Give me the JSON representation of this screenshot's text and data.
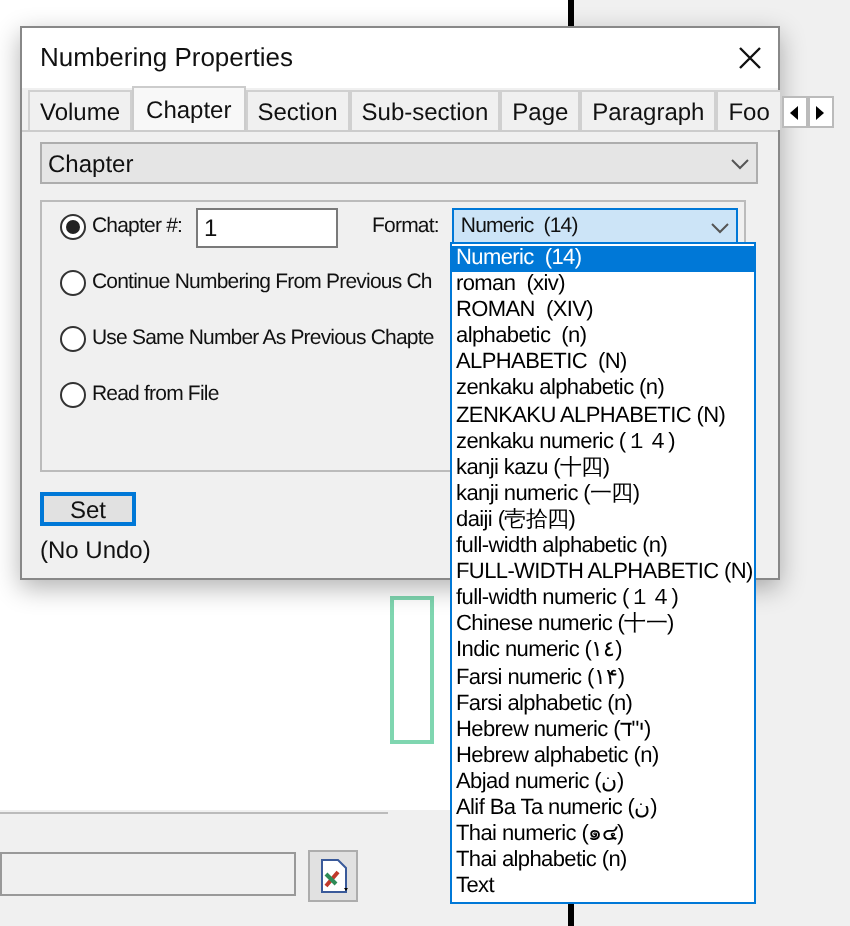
{
  "window": {
    "title": "Numbering Properties"
  },
  "tabs": [
    {
      "label": "Volume",
      "selected": false
    },
    {
      "label": "Chapter",
      "selected": true
    },
    {
      "label": "Section",
      "selected": false
    },
    {
      "label": "Sub-section",
      "selected": false
    },
    {
      "label": "Page",
      "selected": false
    },
    {
      "label": "Paragraph",
      "selected": false
    },
    {
      "label": "Foo",
      "selected": false
    }
  ],
  "level_select": {
    "value": "Chapter"
  },
  "options": [
    {
      "kind": "number",
      "label": "Chapter #:",
      "selected": true,
      "value": "1"
    },
    {
      "kind": "plain",
      "label": "Continue Numbering From Previous Ch",
      "selected": false
    },
    {
      "kind": "plain",
      "label": "Use Same Number As Previous Chapte",
      "selected": false
    },
    {
      "kind": "plain",
      "label": "Read from File",
      "selected": false
    }
  ],
  "format": {
    "label": "Format:",
    "value": "Numeric  (14)",
    "expanded": true,
    "items": [
      {
        "label": "Numeric  (14)",
        "selected": true
      },
      {
        "label": "roman  (xiv)",
        "selected": false
      },
      {
        "label": "ROMAN  (XIV)",
        "selected": false
      },
      {
        "label": "alphabetic  (n)",
        "selected": false
      },
      {
        "label": "ALPHABETIC  (N)",
        "selected": false
      },
      {
        "label": "zenkaku alphabetic (n)",
        "selected": false
      },
      {
        "label": "ZENKAKU ALPHABETIC (N)",
        "selected": false
      },
      {
        "label": "zenkaku numeric (１４)",
        "selected": false
      },
      {
        "label": "kanji kazu (十四)",
        "selected": false
      },
      {
        "label": "kanji numeric (一四)",
        "selected": false
      },
      {
        "label": "daiji (壱拾四)",
        "selected": false
      },
      {
        "label": "full-width alphabetic (n)",
        "selected": false
      },
      {
        "label": "FULL-WIDTH ALPHABETIC (N)",
        "selected": false
      },
      {
        "label": "full-width numeric (１４)",
        "selected": false
      },
      {
        "label": "Chinese numeric (十一)",
        "selected": false
      },
      {
        "label": "Indic numeric (١٤)",
        "selected": false
      },
      {
        "label": "Farsi numeric (۱۴)",
        "selected": false
      },
      {
        "label": "Farsi alphabetic (n)",
        "selected": false
      },
      {
        "label": "Hebrew numeric (י\"ד)",
        "selected": false
      },
      {
        "label": "Hebrew alphabetic (n)",
        "selected": false
      },
      {
        "label": "Abjad numeric (ن)",
        "selected": false
      },
      {
        "label": "Alif Ba Ta numeric (ن)",
        "selected": false
      },
      {
        "label": "Thai numeric (๑๔)",
        "selected": false
      },
      {
        "label": "Thai alphabetic (n)",
        "selected": false
      },
      {
        "label": "Text",
        "selected": false
      }
    ]
  },
  "set_button": "Set",
  "note": "(No Undo)"
}
